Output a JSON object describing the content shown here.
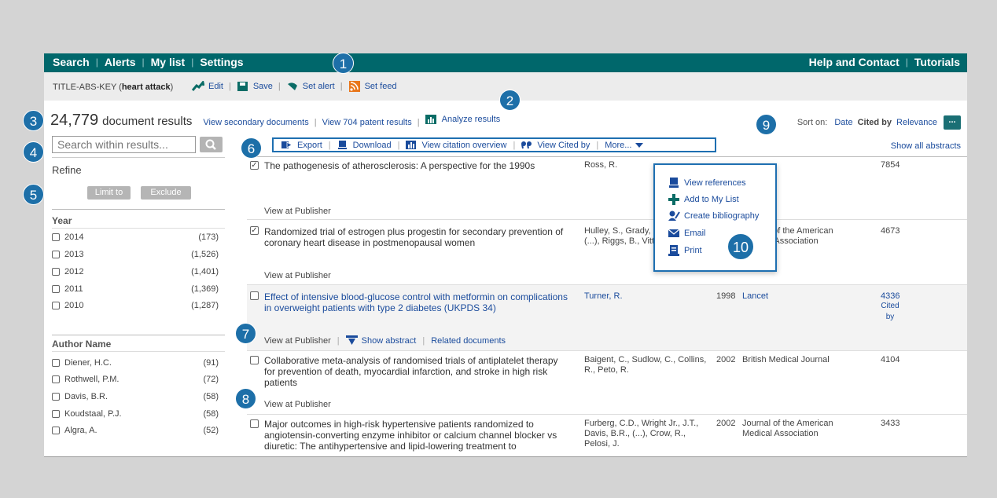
{
  "nav": {
    "left": [
      "Search",
      "Alerts",
      "My list",
      "Settings"
    ],
    "right": [
      "Help and Contact",
      "Tutorials"
    ]
  },
  "query": {
    "prefix": "TITLE-ABS-KEY (",
    "term": "heart attack",
    "suffix": ")",
    "actions": [
      "Edit",
      "Save",
      "Set alert",
      "Set feed"
    ]
  },
  "results": {
    "count": "24,779",
    "label": "document results",
    "links": [
      "View secondary documents",
      "View 704 patent results"
    ],
    "analyze": "Analyze results"
  },
  "sort": {
    "label": "Sort on:",
    "options": [
      "Date",
      "Cited by",
      "Relevance"
    ],
    "more": "..."
  },
  "search": {
    "placeholder": "Search within results..."
  },
  "refine": {
    "title": "Refine",
    "limit": "Limit to",
    "exclude": "Exclude"
  },
  "facets": {
    "year": {
      "title": "Year",
      "items": [
        {
          "label": "2014",
          "count": "(173)"
        },
        {
          "label": "2013",
          "count": "(1,526)"
        },
        {
          "label": "2012",
          "count": "(1,401)"
        },
        {
          "label": "2011",
          "count": "(1,369)"
        },
        {
          "label": "2010",
          "count": "(1,287)"
        }
      ]
    },
    "author": {
      "title": "Author Name",
      "items": [
        {
          "label": "Diener, H.C.",
          "count": "(91)"
        },
        {
          "label": "Rothwell, P.M.",
          "count": "(72)"
        },
        {
          "label": "Davis, B.R.",
          "count": "(58)"
        },
        {
          "label": "Koudstaal, P.J.",
          "count": "(58)"
        },
        {
          "label": "Algra, A.",
          "count": "(52)"
        }
      ]
    }
  },
  "toolbar": {
    "items": [
      "Export",
      "Download",
      "View citation overview",
      "View Cited by",
      "More..."
    ],
    "show_all": "Show all abstracts"
  },
  "rows": [
    {
      "title": "The pathogenesis of atherosclerosis: A perspective for the 1990s",
      "authors": "Ross, R.",
      "year": "",
      "source": "",
      "cited": "7854",
      "view": "View at Publisher"
    },
    {
      "title": "Randomized trial of estrogen plus progestin for secondary prevention of coronary heart disease in postmenopausal women",
      "authors": "Hulley, S., Grady, D., Bush, T., (...), Riggs, B., Vittinghoff, E.",
      "year": "",
      "source": "Journal of the American Medical Association",
      "cited": "4673",
      "view": "View at Publisher"
    },
    {
      "title": "Effect of intensive blood-glucose control with metformin on complications in overweight patients with type 2 diabetes (UKPDS 34)",
      "authors": "Turner, R.",
      "year": "1998",
      "source": "Lancet",
      "cited": "4336",
      "cited_label": "Cited by",
      "view": "View at Publisher",
      "show_abstract": "Show abstract",
      "related": "Related documents"
    },
    {
      "title": "Collaborative meta-analysis of randomised trials of antiplatelet therapy for prevention of death, myocardial infarction, and stroke in high risk patients",
      "authors": "Baigent, C., Sudlow, C., Collins, R., Peto, R.",
      "year": "2002",
      "source": "British Medical Journal",
      "cited": "4104",
      "view": "View at Publisher"
    },
    {
      "title": "Major outcomes in high-risk hypertensive patients randomized to angiotensin-converting enzyme inhibitor or calcium channel blocker vs diuretic: The antihypertensive and lipid-lowering treatment to",
      "authors": "Furberg, C.D., Wright Jr., J.T., Davis, B.R., (...), Crow, R., Pelosi, J.",
      "year": "2002",
      "source": "Journal of the American Medical Association",
      "cited": "3433",
      "view": ""
    }
  ],
  "more_menu": [
    "View references",
    "Add to My List",
    "Create bibliography",
    "Email",
    "Print"
  ],
  "callouts": [
    "1",
    "2",
    "3",
    "4",
    "5",
    "6",
    "7",
    "8",
    "9",
    "10"
  ],
  "colors": {
    "nav": "#00676b",
    "link": "#1a4b9c",
    "callout": "#1d6fa8",
    "highlight_border": "#1e6fb1"
  }
}
